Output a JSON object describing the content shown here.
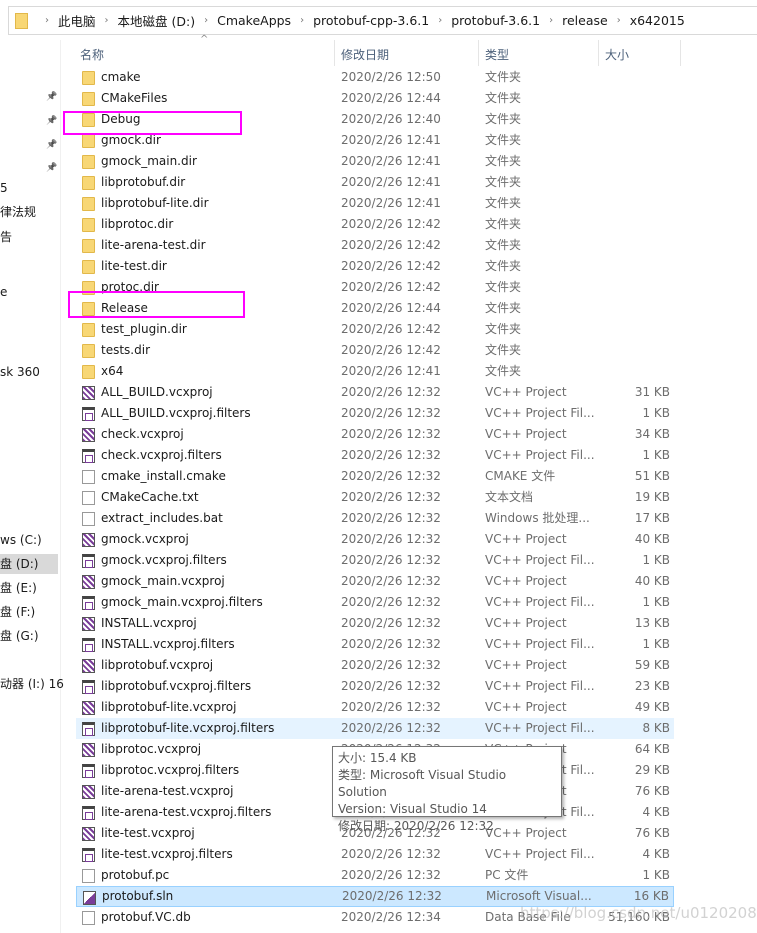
{
  "breadcrumb": [
    "此电脑",
    "本地磁盘 (D:)",
    "CmakeApps",
    "protobuf-cpp-3.6.1",
    "protobuf-3.6.1",
    "release",
    "x642015"
  ],
  "nav": [
    "5",
    "律法规",
    "告",
    "e",
    "sk 360",
    "ws (C:)",
    "盘 (D:)",
    "盘 (E:)",
    "盘 (F:)",
    "盘 (G:)",
    "动器 (I:) 16"
  ],
  "columns": {
    "name": "名称",
    "date": "修改日期",
    "type": "类型",
    "size": "大小"
  },
  "rows": [
    {
      "name": "cmake",
      "date": "2020/2/26 12:50",
      "type": "文件夹",
      "size": "",
      "icon": "folder"
    },
    {
      "name": "CMakeFiles",
      "date": "2020/2/26 12:44",
      "type": "文件夹",
      "size": "",
      "icon": "folder"
    },
    {
      "name": "Debug",
      "date": "2020/2/26 12:40",
      "type": "文件夹",
      "size": "",
      "icon": "folder"
    },
    {
      "name": "gmock.dir",
      "date": "2020/2/26 12:41",
      "type": "文件夹",
      "size": "",
      "icon": "folder"
    },
    {
      "name": "gmock_main.dir",
      "date": "2020/2/26 12:41",
      "type": "文件夹",
      "size": "",
      "icon": "folder"
    },
    {
      "name": "libprotobuf.dir",
      "date": "2020/2/26 12:41",
      "type": "文件夹",
      "size": "",
      "icon": "folder"
    },
    {
      "name": "libprotobuf-lite.dir",
      "date": "2020/2/26 12:41",
      "type": "文件夹",
      "size": "",
      "icon": "folder"
    },
    {
      "name": "libprotoc.dir",
      "date": "2020/2/26 12:42",
      "type": "文件夹",
      "size": "",
      "icon": "folder"
    },
    {
      "name": "lite-arena-test.dir",
      "date": "2020/2/26 12:42",
      "type": "文件夹",
      "size": "",
      "icon": "folder"
    },
    {
      "name": "lite-test.dir",
      "date": "2020/2/26 12:42",
      "type": "文件夹",
      "size": "",
      "icon": "folder"
    },
    {
      "name": "protoc.dir",
      "date": "2020/2/26 12:42",
      "type": "文件夹",
      "size": "",
      "icon": "folder"
    },
    {
      "name": "Release",
      "date": "2020/2/26 12:44",
      "type": "文件夹",
      "size": "",
      "icon": "folder"
    },
    {
      "name": "test_plugin.dir",
      "date": "2020/2/26 12:42",
      "type": "文件夹",
      "size": "",
      "icon": "folder"
    },
    {
      "name": "tests.dir",
      "date": "2020/2/26 12:42",
      "type": "文件夹",
      "size": "",
      "icon": "folder"
    },
    {
      "name": "x64",
      "date": "2020/2/26 12:41",
      "type": "文件夹",
      "size": "",
      "icon": "folder"
    },
    {
      "name": "ALL_BUILD.vcxproj",
      "date": "2020/2/26 12:32",
      "type": "VC++ Project",
      "size": "31 KB",
      "icon": "vcxproj"
    },
    {
      "name": "ALL_BUILD.vcxproj.filters",
      "date": "2020/2/26 12:32",
      "type": "VC++ Project Fil...",
      "size": "1 KB",
      "icon": "filters"
    },
    {
      "name": "check.vcxproj",
      "date": "2020/2/26 12:32",
      "type": "VC++ Project",
      "size": "34 KB",
      "icon": "vcxproj"
    },
    {
      "name": "check.vcxproj.filters",
      "date": "2020/2/26 12:32",
      "type": "VC++ Project Fil...",
      "size": "1 KB",
      "icon": "filters"
    },
    {
      "name": "cmake_install.cmake",
      "date": "2020/2/26 12:32",
      "type": "CMAKE 文件",
      "size": "51 KB",
      "icon": "file"
    },
    {
      "name": "CMakeCache.txt",
      "date": "2020/2/26 12:32",
      "type": "文本文档",
      "size": "19 KB",
      "icon": "txt"
    },
    {
      "name": "extract_includes.bat",
      "date": "2020/2/26 12:32",
      "type": "Windows 批处理...",
      "size": "17 KB",
      "icon": "bat"
    },
    {
      "name": "gmock.vcxproj",
      "date": "2020/2/26 12:32",
      "type": "VC++ Project",
      "size": "40 KB",
      "icon": "vcxproj"
    },
    {
      "name": "gmock.vcxproj.filters",
      "date": "2020/2/26 12:32",
      "type": "VC++ Project Fil...",
      "size": "1 KB",
      "icon": "filters"
    },
    {
      "name": "gmock_main.vcxproj",
      "date": "2020/2/26 12:32",
      "type": "VC++ Project",
      "size": "40 KB",
      "icon": "vcxproj"
    },
    {
      "name": "gmock_main.vcxproj.filters",
      "date": "2020/2/26 12:32",
      "type": "VC++ Project Fil...",
      "size": "1 KB",
      "icon": "filters"
    },
    {
      "name": "INSTALL.vcxproj",
      "date": "2020/2/26 12:32",
      "type": "VC++ Project",
      "size": "13 KB",
      "icon": "vcxproj"
    },
    {
      "name": "INSTALL.vcxproj.filters",
      "date": "2020/2/26 12:32",
      "type": "VC++ Project Fil...",
      "size": "1 KB",
      "icon": "filters"
    },
    {
      "name": "libprotobuf.vcxproj",
      "date": "2020/2/26 12:32",
      "type": "VC++ Project",
      "size": "59 KB",
      "icon": "vcxproj"
    },
    {
      "name": "libprotobuf.vcxproj.filters",
      "date": "2020/2/26 12:32",
      "type": "VC++ Project Fil...",
      "size": "23 KB",
      "icon": "filters"
    },
    {
      "name": "libprotobuf-lite.vcxproj",
      "date": "2020/2/26 12:32",
      "type": "VC++ Project",
      "size": "49 KB",
      "icon": "vcxproj"
    },
    {
      "name": "libprotobuf-lite.vcxproj.filters",
      "date": "2020/2/26 12:32",
      "type": "VC++ Project Fil...",
      "size": "8 KB",
      "icon": "filters",
      "state": "hover"
    },
    {
      "name": "libprotoc.vcxproj",
      "date": "2020/2/26 12:32",
      "type": "VC++ Project",
      "size": "64 KB",
      "icon": "vcxproj"
    },
    {
      "name": "libprotoc.vcxproj.filters",
      "date": "2020/2/26 12:32",
      "type": "VC++ Project Fil...",
      "size": "29 KB",
      "icon": "filters"
    },
    {
      "name": "lite-arena-test.vcxproj",
      "date": "2020/2/26 12:32",
      "type": "VC++ Project",
      "size": "76 KB",
      "icon": "vcxproj"
    },
    {
      "name": "lite-arena-test.vcxproj.filters",
      "date": "2020/2/26 12:32",
      "type": "VC++ Project Fil...",
      "size": "4 KB",
      "icon": "filters"
    },
    {
      "name": "lite-test.vcxproj",
      "date": "2020/2/26 12:32",
      "type": "VC++ Project",
      "size": "76 KB",
      "icon": "vcxproj"
    },
    {
      "name": "lite-test.vcxproj.filters",
      "date": "2020/2/26 12:32",
      "type": "VC++ Project Fil...",
      "size": "4 KB",
      "icon": "filters"
    },
    {
      "name": "protobuf.pc",
      "date": "2020/2/26 12:32",
      "type": "PC 文件",
      "size": "1 KB",
      "icon": "file"
    },
    {
      "name": "protobuf.sln",
      "date": "2020/2/26 12:32",
      "type": "Microsoft Visual...",
      "size": "16 KB",
      "icon": "sln",
      "state": "selected"
    },
    {
      "name": "protobuf.VC.db",
      "date": "2020/2/26 12:34",
      "type": "Data Base File",
      "size": "51,160 KB",
      "icon": "db"
    }
  ],
  "tooltip": [
    "大小: 15.4 KB",
    "类型: Microsoft Visual Studio Solution",
    "Version: Visual Studio 14",
    "修改日期: 2020/2/26 12:32"
  ],
  "watermark": "https://blog.csdn.net/u012020854",
  "colors": {
    "highlight_box": "#ff00ff",
    "selected": "#cce8ff",
    "hover": "#e5f3ff"
  }
}
